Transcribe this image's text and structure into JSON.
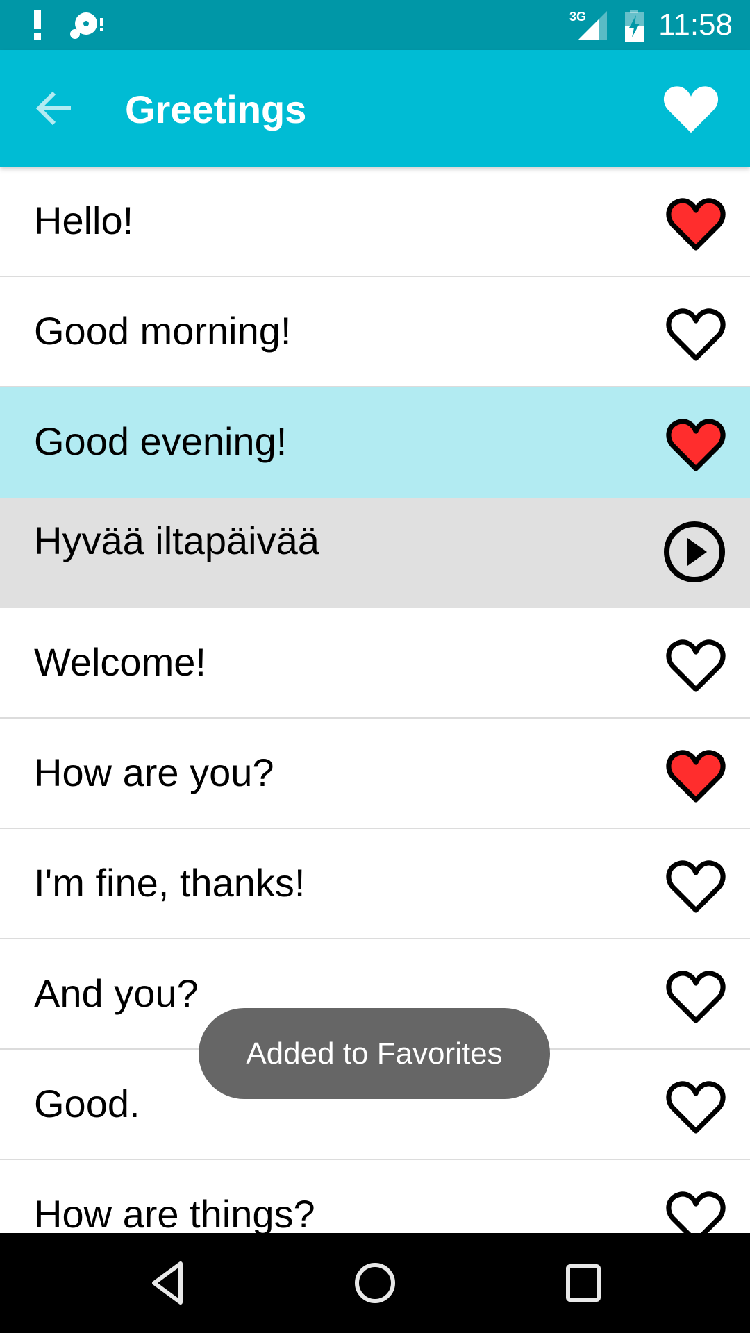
{
  "status_bar": {
    "time": "11:58",
    "network_type": "3G",
    "icons": [
      "alert-icon",
      "sync-error-icon",
      "signal-3g-icon",
      "battery-charging-icon"
    ]
  },
  "toolbar": {
    "title": "Greetings",
    "back_icon": "arrow-back-icon",
    "favorites_icon": "heart-icon"
  },
  "colors": {
    "status_bar": "#0097a7",
    "toolbar": "#00bcd4",
    "selected_row": "#b2ebf2",
    "translation_row": "#e0e0e0",
    "favorite_heart": "#ff2d2d",
    "toast": "#666666"
  },
  "list": {
    "items": [
      {
        "text": "Hello!",
        "favorite": true,
        "state": "normal",
        "icon": "heart-icon"
      },
      {
        "text": "Good morning!",
        "favorite": false,
        "state": "normal",
        "icon": "heart-outline-icon"
      },
      {
        "text": "Good evening!",
        "favorite": true,
        "state": "selected",
        "icon": "heart-icon"
      },
      {
        "text": "Hyvää iltapäivää",
        "favorite": null,
        "state": "translation",
        "icon": "play-circle-icon"
      },
      {
        "text": "Welcome!",
        "favorite": false,
        "state": "normal",
        "icon": "heart-outline-icon"
      },
      {
        "text": "How are you?",
        "favorite": true,
        "state": "normal",
        "icon": "heart-icon"
      },
      {
        "text": "I'm fine, thanks!",
        "favorite": false,
        "state": "normal",
        "icon": "heart-outline-icon"
      },
      {
        "text": "And you?",
        "favorite": false,
        "state": "normal",
        "icon": "heart-outline-icon"
      },
      {
        "text": "Good.",
        "favorite": false,
        "state": "normal",
        "icon": "heart-outline-icon"
      },
      {
        "text": "How are things?",
        "favorite": false,
        "state": "normal",
        "icon": "heart-outline-icon"
      }
    ]
  },
  "toast": {
    "message": "Added to Favorites"
  },
  "nav_bar": {
    "buttons": [
      "back-icon",
      "home-icon",
      "recents-icon"
    ]
  }
}
